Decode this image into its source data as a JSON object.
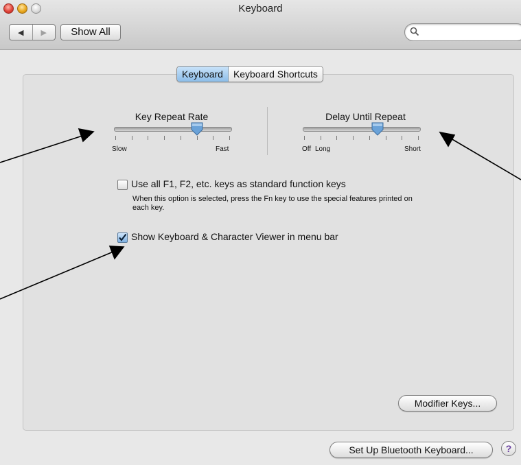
{
  "window": {
    "title": "Keyboard"
  },
  "toolbar": {
    "back_icon": "◀",
    "forward_icon": "▶",
    "show_all_label": "Show All",
    "search_placeholder": ""
  },
  "tabs": [
    {
      "label": "Keyboard",
      "selected": true
    },
    {
      "label": "Keyboard Shortcuts",
      "selected": false
    }
  ],
  "key_repeat": {
    "label": "Key Repeat Rate",
    "min_label": "Slow",
    "max_label": "Fast",
    "value_fraction": 0.71
  },
  "delay_until_repeat": {
    "label": "Delay Until Repeat",
    "min_label": "Off",
    "min_label2": "Long",
    "max_label": "Short",
    "value_fraction": 0.64
  },
  "options": {
    "fn_keys": {
      "label": "Use all F1, F2, etc. keys as standard function keys",
      "help": "When this option is selected, press the Fn key to use the special features printed on each key.",
      "checked": false
    },
    "show_viewer": {
      "label": "Show Keyboard & Character Viewer in menu bar",
      "checked": true
    }
  },
  "buttons": {
    "modifier_keys": "Modifier Keys...",
    "bluetooth": "Set Up Bluetooth Keyboard...",
    "help": "?"
  },
  "colors": {
    "accent": "#8cbde9",
    "thumb": "#6aa2d8",
    "annotation_arrow": "#000000"
  }
}
